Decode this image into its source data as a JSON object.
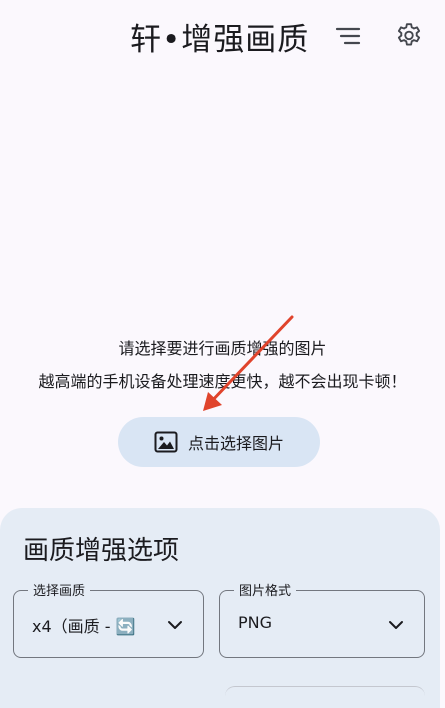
{
  "topbar": {
    "title": "轩•增强画质",
    "menu_icon": "sort-lines-icon",
    "settings_icon": "gear-icon"
  },
  "main": {
    "hint_line1": "请选择要进行画质增强的图片",
    "hint_line2": "越高端的手机设备处理速度更快，越不会出现卡顿！",
    "pick_button": {
      "icon": "image-icon",
      "label": "点击选择图片"
    },
    "annotation_arrow_color": "#e0442c"
  },
  "options": {
    "title": "画质增强选项",
    "quality": {
      "label": "选择画质",
      "value": "x4（画质 - 🔄"
    },
    "format": {
      "label": "图片格式",
      "value": "PNG"
    }
  },
  "colors": {
    "background": "#fbf8fd",
    "button_bg": "#d9e5f4",
    "card_bg": "#e5ecf5",
    "outline": "#73777f"
  }
}
